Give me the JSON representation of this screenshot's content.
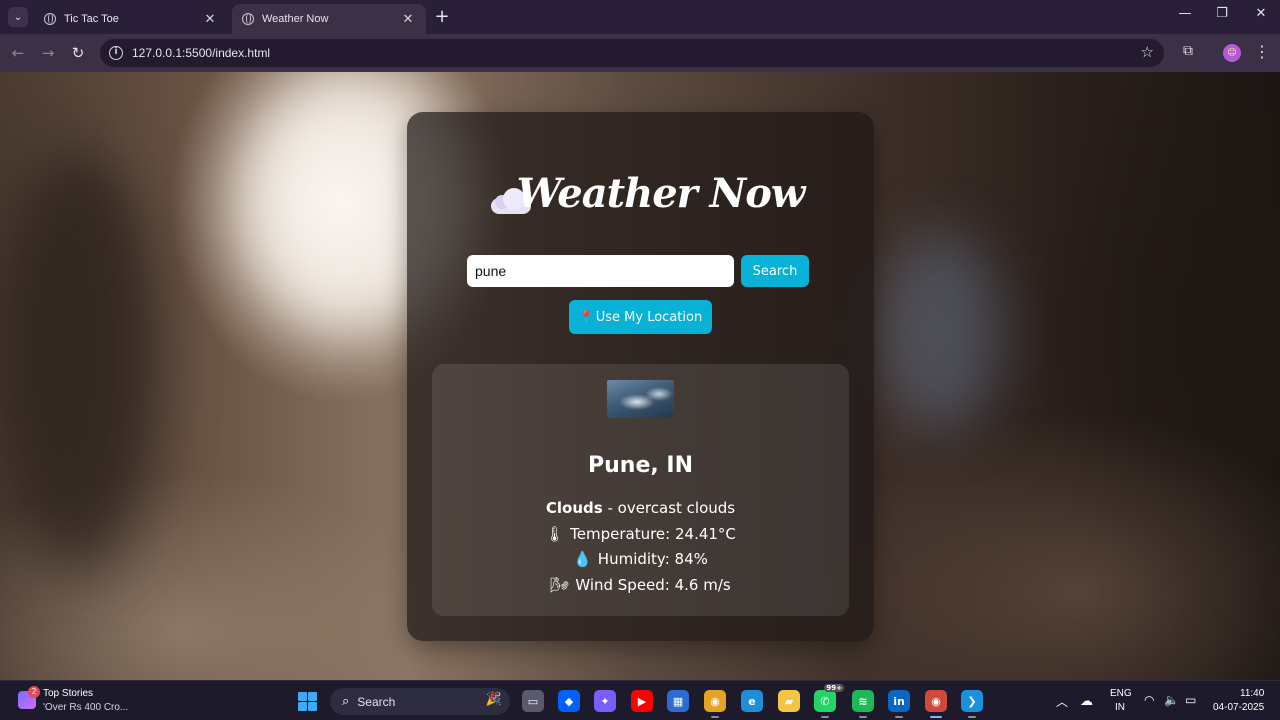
{
  "browser": {
    "tabs": [
      {
        "title": "Tic Tac Toe",
        "close": "✕"
      },
      {
        "title": "Weather Now",
        "close": "✕"
      }
    ],
    "new_tab": "+",
    "window_controls": {
      "minimize": "—",
      "maximize": "❐",
      "close": "✕"
    },
    "url": "127.0.0.1:5500/index.html",
    "nav": {
      "back": "←",
      "forward": "→",
      "reload": "↻"
    },
    "star": "☆",
    "menu": "⋮",
    "tab_menu": "⌄"
  },
  "app": {
    "title": "Weather Now",
    "title_icon": "cloud-icon",
    "search": {
      "value": "pune",
      "button": "Search"
    },
    "location_button": "Use My Location",
    "location_icon": "pin-icon",
    "result": {
      "city": "Pune, IN",
      "condition": "Clouds",
      "description": " - overcast clouds",
      "temperature": "Temperature: 24.41°C",
      "humidity": "Humidity: 84%",
      "wind": "Wind Speed: 4.6 m/s",
      "temperature_icon": "🌡",
      "humidity_icon": "💧",
      "wind_icon": "🌬"
    }
  },
  "taskbar": {
    "news": {
      "badge": "2",
      "title": "Top Stories",
      "subtitle": "'Over Rs 400 Cro..."
    },
    "search_label": "Search",
    "apps": [
      {
        "name": "task-view",
        "glyph": "▭",
        "color": "#5a5a6e"
      },
      {
        "name": "dropbox",
        "glyph": "◆",
        "color": "#0061ff"
      },
      {
        "name": "copilot",
        "glyph": "✦",
        "color": "#7b5cff"
      },
      {
        "name": "youtube",
        "glyph": "▶",
        "color": "#ff0000"
      },
      {
        "name": "store",
        "glyph": "▦",
        "color": "#2b6cd4"
      },
      {
        "name": "chrome",
        "glyph": "◉",
        "color": "#e4a322"
      },
      {
        "name": "edge",
        "glyph": "e",
        "color": "#1e8fd6"
      },
      {
        "name": "file-explorer",
        "glyph": "▰",
        "color": "#f4c542"
      },
      {
        "name": "whatsapp",
        "glyph": "✆",
        "color": "#25d366",
        "badge": "99+"
      },
      {
        "name": "spotify",
        "glyph": "≋",
        "color": "#1db954"
      },
      {
        "name": "linkedin",
        "glyph": "in",
        "color": "#0a66c2"
      },
      {
        "name": "chrome-active",
        "glyph": "◉",
        "color": "#d04a3c"
      },
      {
        "name": "vscode",
        "glyph": "❯",
        "color": "#1d8fe1"
      }
    ],
    "tray": {
      "lang_1": "ENG",
      "lang_2": "IN",
      "time": "11:40",
      "date": "04-07-2025"
    }
  }
}
